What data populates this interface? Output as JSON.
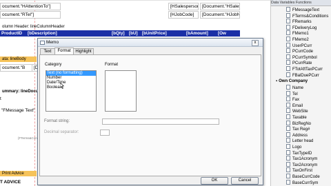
{
  "designer": {
    "row1_fields": [
      "ocument.\"HAttentionTo\"]",
      "[HSalesperson",
      "[Document.\"HSalesper"
    ],
    "row2_fields": [
      "ocument.\"RTel\"]",
      "[HJobCode]",
      "[Document.\"HJobNo\""
    ],
    "col_header_band": "olumn Header: lineColumnHeader",
    "col_header_labels": [
      "ProductID",
      "[bDescription]",
      "[bQty]",
      "[bU]",
      "[bUnitPrice]",
      "[bAmount]",
      "[Ow"
    ],
    "detail_band": "ata: lineBody",
    "detail_field": "ocument.\"B",
    "detail_field2": "[D",
    "summary_band": "ummary: lineDocume",
    "summary_text1": "t",
    "summary_text2": "\"FMessage Text\"",
    "formula_text": "{FTerms&Condition",
    "footer_band": "Print Advice",
    "footer_text": "T ADVICE"
  },
  "right_panel": {
    "tabs": "Data  Variables  Functions",
    "items_top": [
      "FMessageText",
      "FTerms&Conditions",
      "FRemarks",
      "FDeliveryLog",
      "FMemo1",
      "FMemo2",
      "UserPCurr",
      "PCurrCode",
      "PCurrSymbol",
      "PCurrRate",
      "FTotAftTaxPCurr",
      "FBalDuePCurr"
    ],
    "own_company": "Own Company",
    "items_bottom": [
      "Name",
      "Tel",
      "Fax",
      "Email",
      "WebSite",
      "Taxable",
      "BizRegNo",
      "Tax Reg#",
      "Address",
      "Letter head",
      "Logo",
      "TaxTypeID",
      "Tax1Acronym",
      "Tax2Acronym",
      "TaxOnFirst",
      "BaseCurrCode",
      "BaseCurrSym"
    ]
  },
  "dialog": {
    "title": "Memo",
    "tabs": [
      "Text",
      "Format",
      "Highlight"
    ],
    "category_label": "Category",
    "format_label": "Format",
    "categories": [
      "Text (no formatting)",
      "Number",
      "Date/Time",
      "Boolean"
    ],
    "selected_category": "Text (no formatting)",
    "format_string_label": "Format string:",
    "decimal_separator_label": "Decimal separator:",
    "ok_label": "OK",
    "cancel_label": "Cancel",
    "close_glyph": "x"
  }
}
